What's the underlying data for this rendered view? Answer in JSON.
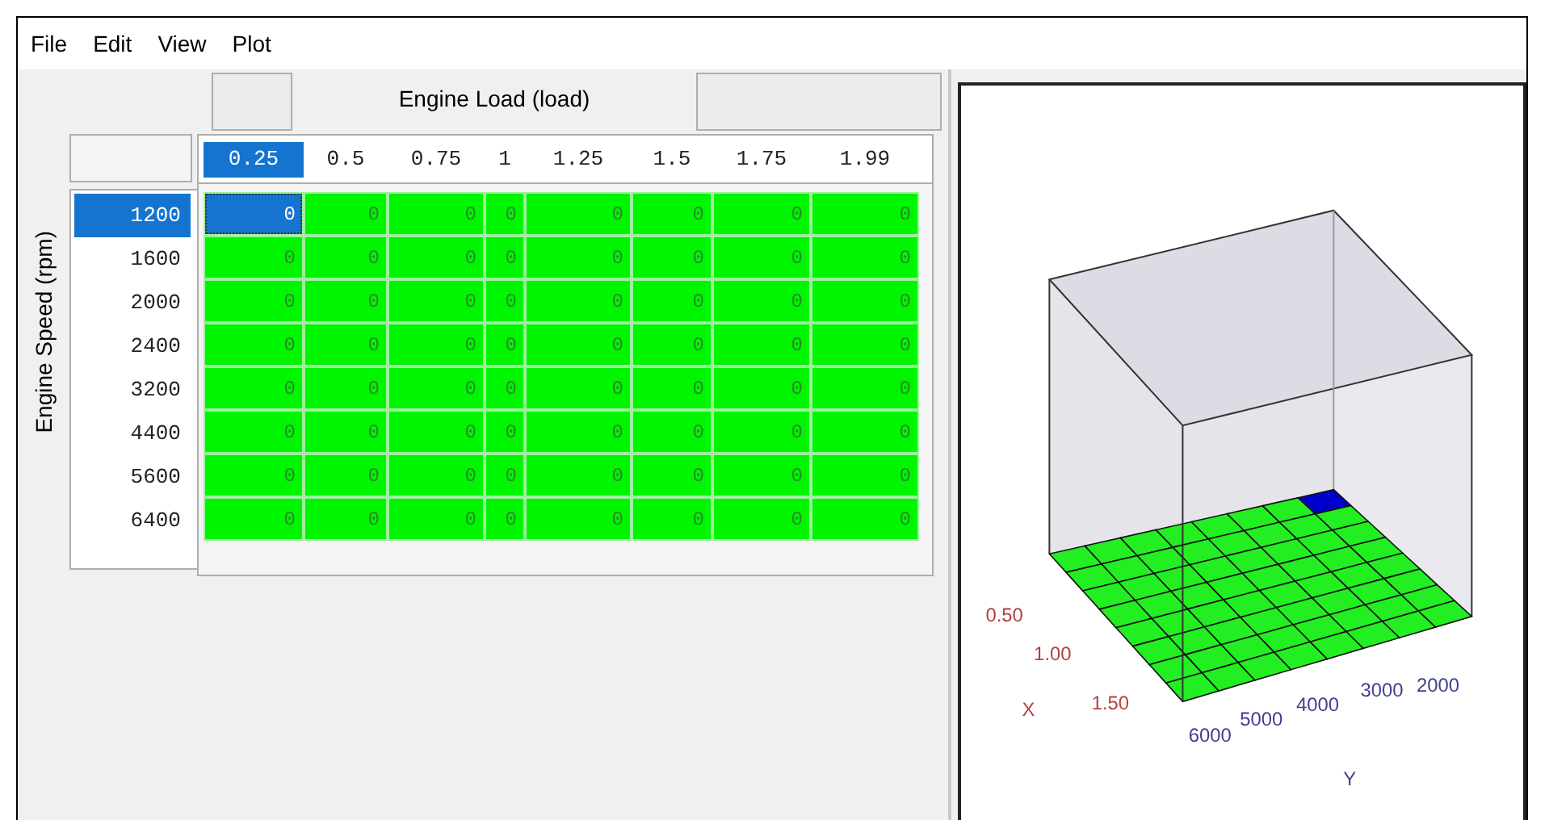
{
  "menu": [
    {
      "label": "File"
    },
    {
      "label": "Edit"
    },
    {
      "label": "View"
    },
    {
      "label": "Plot"
    }
  ],
  "table": {
    "x_axis_title": "Engine Load (load)",
    "y_axis_title": "Engine Speed (rpm)",
    "columns": [
      {
        "label": "0.25",
        "selected": true
      },
      {
        "label": "0.5",
        "selected": false
      },
      {
        "label": "0.75",
        "selected": false
      },
      {
        "label": "1",
        "selected": false
      },
      {
        "label": "1.25",
        "selected": false
      },
      {
        "label": "1.5",
        "selected": false
      },
      {
        "label": "1.75",
        "selected": false
      },
      {
        "label": "1.99",
        "selected": false
      }
    ],
    "rows": [
      {
        "label": "1200",
        "selected": true,
        "cells": [
          {
            "value": "0",
            "selected": true
          },
          {
            "value": "0",
            "selected": false
          },
          {
            "value": "0",
            "selected": false
          },
          {
            "value": "0",
            "selected": false
          },
          {
            "value": "0",
            "selected": false
          },
          {
            "value": "0",
            "selected": false
          },
          {
            "value": "0",
            "selected": false
          },
          {
            "value": "0",
            "selected": false
          }
        ]
      },
      {
        "label": "1600",
        "selected": false,
        "cells": [
          {
            "value": "0",
            "selected": false
          },
          {
            "value": "0",
            "selected": false
          },
          {
            "value": "0",
            "selected": false
          },
          {
            "value": "0",
            "selected": false
          },
          {
            "value": "0",
            "selected": false
          },
          {
            "value": "0",
            "selected": false
          },
          {
            "value": "0",
            "selected": false
          },
          {
            "value": "0",
            "selected": false
          }
        ]
      },
      {
        "label": "2000",
        "selected": false,
        "cells": [
          {
            "value": "0",
            "selected": false
          },
          {
            "value": "0",
            "selected": false
          },
          {
            "value": "0",
            "selected": false
          },
          {
            "value": "0",
            "selected": false
          },
          {
            "value": "0",
            "selected": false
          },
          {
            "value": "0",
            "selected": false
          },
          {
            "value": "0",
            "selected": false
          },
          {
            "value": "0",
            "selected": false
          }
        ]
      },
      {
        "label": "2400",
        "selected": false,
        "cells": [
          {
            "value": "0",
            "selected": false
          },
          {
            "value": "0",
            "selected": false
          },
          {
            "value": "0",
            "selected": false
          },
          {
            "value": "0",
            "selected": false
          },
          {
            "value": "0",
            "selected": false
          },
          {
            "value": "0",
            "selected": false
          },
          {
            "value": "0",
            "selected": false
          },
          {
            "value": "0",
            "selected": false
          }
        ]
      },
      {
        "label": "3200",
        "selected": false,
        "cells": [
          {
            "value": "0",
            "selected": false
          },
          {
            "value": "0",
            "selected": false
          },
          {
            "value": "0",
            "selected": false
          },
          {
            "value": "0",
            "selected": false
          },
          {
            "value": "0",
            "selected": false
          },
          {
            "value": "0",
            "selected": false
          },
          {
            "value": "0",
            "selected": false
          },
          {
            "value": "0",
            "selected": false
          }
        ]
      },
      {
        "label": "4400",
        "selected": false,
        "cells": [
          {
            "value": "0",
            "selected": false
          },
          {
            "value": "0",
            "selected": false
          },
          {
            "value": "0",
            "selected": false
          },
          {
            "value": "0",
            "selected": false
          },
          {
            "value": "0",
            "selected": false
          },
          {
            "value": "0",
            "selected": false
          },
          {
            "value": "0",
            "selected": false
          },
          {
            "value": "0",
            "selected": false
          }
        ]
      },
      {
        "label": "5600",
        "selected": false,
        "cells": [
          {
            "value": "0",
            "selected": false
          },
          {
            "value": "0",
            "selected": false
          },
          {
            "value": "0",
            "selected": false
          },
          {
            "value": "0",
            "selected": false
          },
          {
            "value": "0",
            "selected": false
          },
          {
            "value": "0",
            "selected": false
          },
          {
            "value": "0",
            "selected": false
          },
          {
            "value": "0",
            "selected": false
          }
        ]
      },
      {
        "label": "6400",
        "selected": false,
        "cells": [
          {
            "value": "0",
            "selected": false
          },
          {
            "value": "0",
            "selected": false
          },
          {
            "value": "0",
            "selected": false
          },
          {
            "value": "0",
            "selected": false
          },
          {
            "value": "0",
            "selected": false
          },
          {
            "value": "0",
            "selected": false
          },
          {
            "value": "0",
            "selected": false
          },
          {
            "value": "0",
            "selected": false
          }
        ]
      }
    ]
  },
  "plot": {
    "x_label": "X",
    "y_label": "Y",
    "x_ticks": [
      "0.50",
      "1.00",
      "1.50"
    ],
    "y_ticks": [
      "6000",
      "5000",
      "4000",
      "3000",
      "2000"
    ]
  }
}
